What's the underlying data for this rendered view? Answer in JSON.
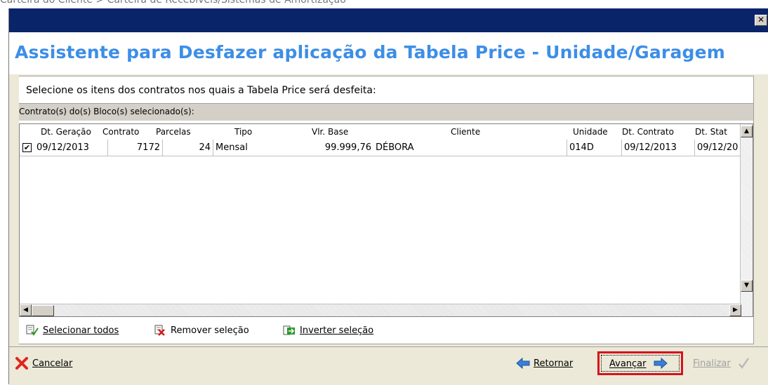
{
  "breadcrumb": "Carteira do Cliente > Carteira de Recebíveis/Sistemas de Amortização",
  "window": {
    "close_label": "✕",
    "title": "Assistente para Desfazer aplicação da Tabela Price - Unidade/Garagem"
  },
  "instruction": "Selecione os itens dos contratos nos quais a Tabela Price será desfeita:",
  "group_bar": "Contrato(s) do(s) Bloco(s) selecionado(s):",
  "grid": {
    "columns": [
      "Dt. Geração",
      "Contrato",
      "Parcelas",
      "Tipo",
      "Vlr. Base",
      "Cliente",
      "Unidade",
      "Dt. Contrato",
      "Dt. Stat"
    ],
    "rows": [
      {
        "checked": "✔",
        "dt_geracao": "09/12/2013",
        "contrato": "7172",
        "parcelas": "24",
        "tipo": "Mensal",
        "vlr_base": "99.999,76",
        "cliente": "DÉBORA",
        "unidade": "014D",
        "dt_contrato": "09/12/2013",
        "dt_stat": "09/12/20"
      }
    ]
  },
  "actions": {
    "select_all": "Selecionar todos",
    "remove_selection": "Remover seleção",
    "invert_selection": "Inverter seleção"
  },
  "footer": {
    "cancel": "Cancelar",
    "back": "Retornar",
    "next": "Avançar",
    "finish": "Finalizar"
  },
  "colors": {
    "title_blue": "#3d8ee6",
    "titlebar": "#0a246a",
    "highlight_red": "#d4141b"
  }
}
